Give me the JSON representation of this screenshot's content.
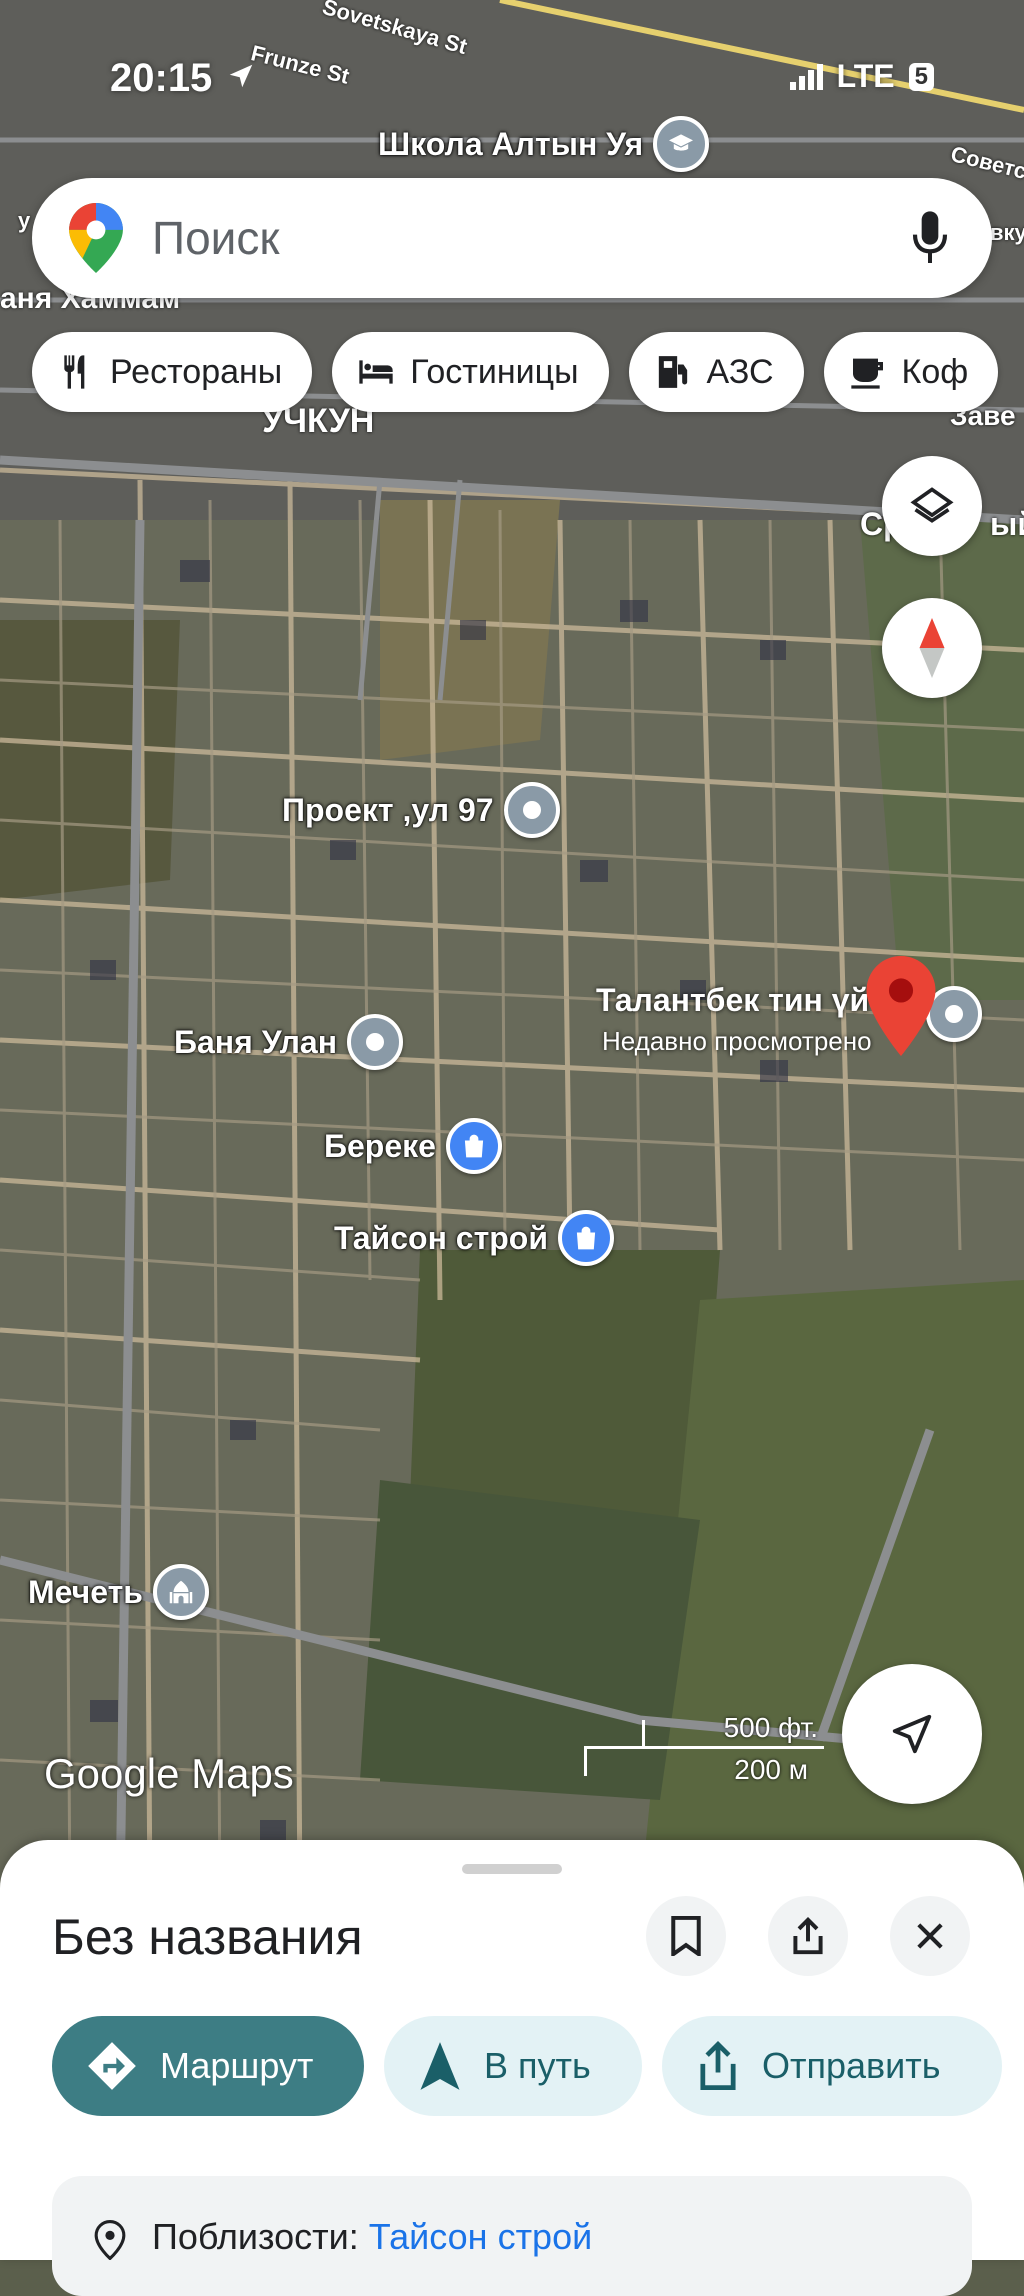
{
  "status_bar": {
    "time": "20:15",
    "network": "LTE",
    "battery": "5"
  },
  "search": {
    "placeholder": "Поиск"
  },
  "chips": [
    {
      "label": "Рестораны",
      "icon": "fork-knife-icon"
    },
    {
      "label": "Гостиницы",
      "icon": "bed-icon"
    },
    {
      "label": "АЗС",
      "icon": "gas-station-icon"
    },
    {
      "label": "Коф",
      "icon": "coffee-icon"
    }
  ],
  "map": {
    "streets": {
      "sovetskaya": "Sovetskaya St",
      "frunze": "Frunze St",
      "sovetskaya_ru": "Советс",
      "ru_right": "вкун",
      "district": "УЧКУН",
      "khammam": "аня Хаммам",
      "zav": "Заве",
      "sr": "Сре",
      "uy": "ый",
      "left_edge": "у"
    },
    "places": {
      "school": "Школа Алтын Уя",
      "proekt": "Проект ,ул 97",
      "talantbek": "Талантбек тин үй",
      "recent": "Недавно просмотрено",
      "banya": "Баня Улан",
      "bereke": "Береке",
      "tayson": "Тайсон строй",
      "mosque": "Мечеть"
    },
    "scale": {
      "ft": "500 фт.",
      "m": "200 м"
    },
    "watermark": "Google Maps"
  },
  "sheet": {
    "title": "Без названия",
    "route_label": "Маршрут",
    "go_label": "В путь",
    "share_label": "Отправить",
    "address_prefix": "Поблизости: ",
    "address_link": "Тайсон строй"
  },
  "colors": {
    "accent": "#3d7d84",
    "pin": "#ea4335",
    "blue_marker": "#4285f4"
  }
}
